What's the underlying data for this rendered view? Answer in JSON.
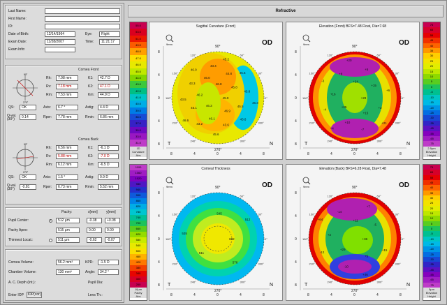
{
  "patient": {
    "last_name_label": "Last Name:",
    "first_name_label": "First Name:",
    "id_label": "ID:",
    "dob_label": "Date of Birth:",
    "dob_value": "12/14/1964",
    "eye_label": "Eye:",
    "eye_value": "Right",
    "exam_date_label": "Exam Date:",
    "exam_date_value": "11/28/2007",
    "time_label": "Time:",
    "time_value": "11:21:17",
    "exam_info_label": "Exam Info:"
  },
  "cornea_front": {
    "title": "Cornea Front",
    "rh_label": "Rh:",
    "rh": "7.98 mm",
    "k1_label": "K1:",
    "k1": "42.7 D",
    "rv_label": "Rv:",
    "rv": "7.18 mm",
    "k2_label": "K2:",
    "k2": "47.1 D",
    "rm_label": "Rm:",
    "rm": "7.53 mm",
    "km_label": "Km:",
    "km": "44.9 D",
    "qs_label": "QS:",
    "qs": "OK",
    "axis_label": "Axis:",
    "axis": "6.7 °",
    "astig_label": "Astig:",
    "astig": "4.4 D",
    "qval_label": "Q-val. (30°)",
    "qval": "0.14",
    "rper_label": "Rper:",
    "rper": "7.78 mm",
    "rmin_label": "Rmin:",
    "rmin": "6.86 mm"
  },
  "cornea_back": {
    "title": "Cornea Back",
    "rh_label": "Rh:",
    "rh": "6.56 mm",
    "k1_label": "K1:",
    "k1": "-6.1 D",
    "rv_label": "Rv:",
    "rv": "5.88 mm",
    "k2_label": "K2:",
    "k2": "-7.0 D",
    "rm_label": "Rm:",
    "rm": "6.12 mm",
    "km_label": "Km:",
    "km": "-6.5 D",
    "qs_label": "QS:",
    "qs": "OK",
    "axis_label": "Axis:",
    "axis": "1.5 °",
    "astig_label": "Astig:",
    "astig": "0.9 D",
    "qval_label": "Q-val. (30°)",
    "qval": "-0.81",
    "rper_label": "Rper:",
    "rper": "6.73 mm",
    "rmin_label": "Rmin:",
    "rmin": "5.52 mm"
  },
  "pachy": {
    "head_pachy": "Pachy:",
    "head_x": "x[mm]",
    "head_y": "y[mm]",
    "rows": [
      {
        "label": "Pupil Center:",
        "pachy": "512 µm",
        "x": "-0.38",
        "y": "+0.08"
      },
      {
        "label": "Pachy Apex:",
        "pachy": "515 µm",
        "x": "0.00",
        "y": "0.00"
      },
      {
        "label": "Thinnest Locat.:",
        "pachy": "511 µm",
        "x": "-0.62",
        "y": "-0.07"
      }
    ]
  },
  "volume": {
    "cv_label": "Cornea Volume:",
    "cv": "56.2 mm³",
    "kpd_label": "KPD:",
    "kpd": "-1.5 D",
    "ch_label": "Chamber Volume:",
    "ch": "130 mm³",
    "angle_label": "Angle:",
    "angle": "34.2 °",
    "acd_label": "A. C. Depth (Int.):",
    "pupil_label": "Pupil Dia:",
    "iop_label": "Enter IOP",
    "iop_btn": "IOP(cor)",
    "lens_label": "Lens Th.:"
  },
  "right": {
    "title": "Refractive",
    "maps": [
      {
        "title": "Sagittal Curvature (Front)",
        "eye": "OD",
        "zoom": "9mm"
      },
      {
        "title": "Elevation (Front) BFS=7.48 Float, Dia=7.68",
        "eye": "OD",
        "zoom": "9mm"
      },
      {
        "title": "Corneal Thickness",
        "eye": "OD",
        "zoom": "9mm"
      },
      {
        "title": "Elevation (Back) BFS=6.28 Float, Dia=7.48",
        "eye": "OD",
        "zoom": "9mm"
      }
    ],
    "axis": {
      "top": "90°",
      "bottom": "270°",
      "left_text": "T",
      "right_text": "N",
      "deg": [
        "120°",
        "60°",
        "150°",
        "30°",
        "180°",
        "0°",
        "210°",
        "330°",
        "240°",
        "300°"
      ],
      "ticks": [
        "8",
        "4",
        "0",
        "4",
        "8"
      ]
    },
    "scale_curv": [
      "55.0",
      "53.0",
      "51.0",
      "49.0",
      "48.0",
      "47.0",
      "46.0",
      "45.0",
      "44.0",
      "43.0",
      "42.0",
      "41.0",
      "40.0",
      "39.0",
      "38.0",
      "37.0",
      "35.0",
      "33.0",
      "31.0"
    ],
    "scale_curv_foot": [
      "1D",
      "Curvature",
      "Abs"
    ],
    "scale_elev": [
      "75",
      "65",
      "55",
      "45",
      "40",
      "35",
      "30",
      "25",
      "20",
      "15",
      "10",
      "5",
      "0",
      "-5",
      "-10",
      "-15",
      "-20",
      "-25",
      "-30",
      "-35",
      "-45",
      "-55",
      "-65",
      "-75"
    ],
    "scale_elev_foot": [
      "2.5µm",
      "Elevation",
      "Height"
    ],
    "scale_pachy": [
      "1100",
      "1060",
      "1020",
      "980",
      "940",
      "900",
      "860",
      "820",
      "780",
      "740",
      "700",
      "660",
      "620",
      "580",
      "540",
      "500",
      "460",
      "420",
      "380",
      "340",
      "300",
      "260"
    ],
    "scale_pachy_foot": [
      "10µm",
      "Pachy",
      "Abs"
    ],
    "scale_elevb_foot": [
      "5µm",
      "Elevation",
      "Height"
    ],
    "curv_vals": [
      "45.9",
      "46.3",
      "46.8",
      "46.9",
      "46.2",
      "45.8",
      "46.1",
      "46.0",
      "45.5",
      "45.1",
      "44.8",
      "43.6",
      "43.3",
      "43.8",
      "43.2",
      "43.4",
      "43.6",
      "43.5",
      "45.6",
      "45.6",
      "46.0",
      "46.3",
      "46.6",
      "45.2"
    ],
    "pachy_vals": [
      "602",
      "511",
      "545",
      "576",
      "535",
      "512"
    ],
    "elev_front_vals": [
      "+29",
      "+25",
      "+24",
      "+15",
      "+16",
      "+15",
      "+10",
      "+8",
      "+2",
      "-4",
      "+5",
      "-7",
      "-3",
      "+6",
      "+4",
      "+20",
      "+21"
    ],
    "elev_back_vals": [
      "+36",
      "+29",
      "+11",
      "+5",
      "+2",
      "-5",
      "-10",
      "-14",
      "+15",
      "-12",
      "+7",
      "+46",
      "+64"
    ]
  }
}
